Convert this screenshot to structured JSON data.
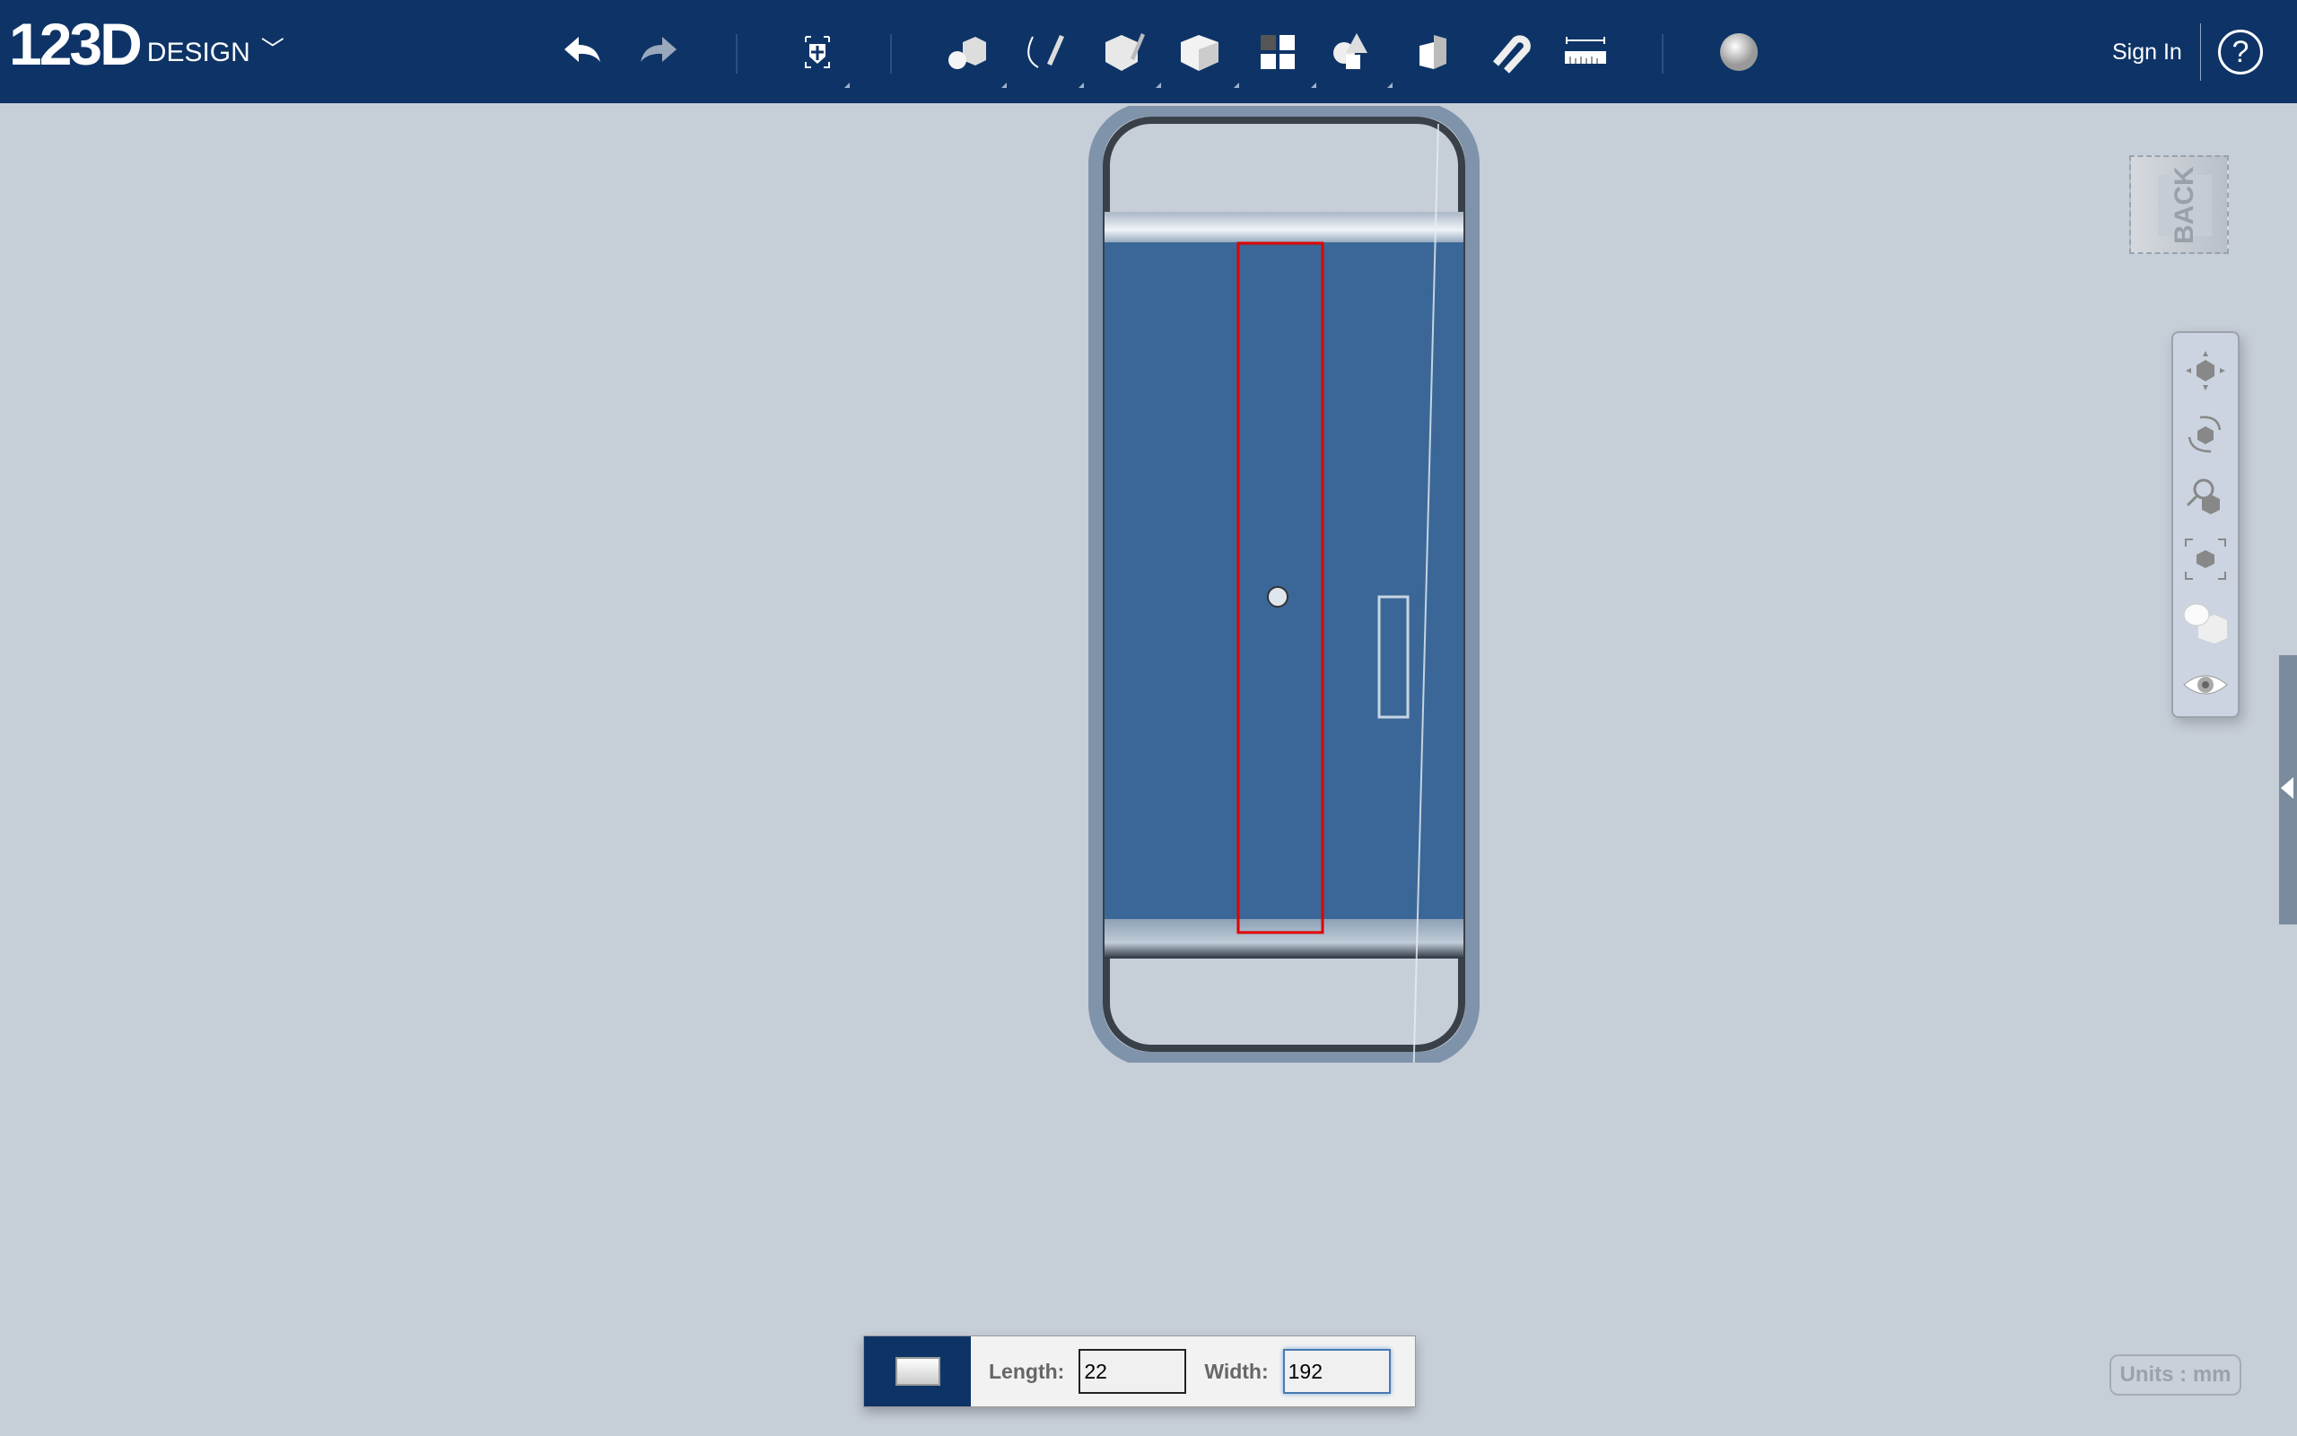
{
  "app": {
    "logo_number": "123D",
    "logo_word": "DESIGN",
    "menu_chevron": "﹀"
  },
  "toolbar": {
    "tools": [
      "undo-icon",
      "redo-icon",
      "transform-icon",
      "primitives-icon",
      "sketch-icon",
      "construct-icon",
      "modify-icon",
      "pattern-icon",
      "group-icon",
      "combine-icon",
      "snap-icon",
      "measure-icon",
      "material-icon"
    ],
    "sign_in": "Sign In",
    "help": "?"
  },
  "viewcube": {
    "face": "BACK"
  },
  "navigation": [
    "pan-icon",
    "orbit-icon",
    "zoom-icon",
    "fit-icon",
    "view-mode-icon",
    "visibility-icon"
  ],
  "dimension_panel": {
    "length_label": "Length:",
    "length_value": "22",
    "width_label": "Width:",
    "width_value": "192"
  },
  "status": {
    "units": "Units : mm"
  },
  "colors": {
    "toolbar": "#0e3467",
    "viewport": "#c6ced8",
    "selection": "#e00000",
    "model_face": "#3a6797"
  }
}
